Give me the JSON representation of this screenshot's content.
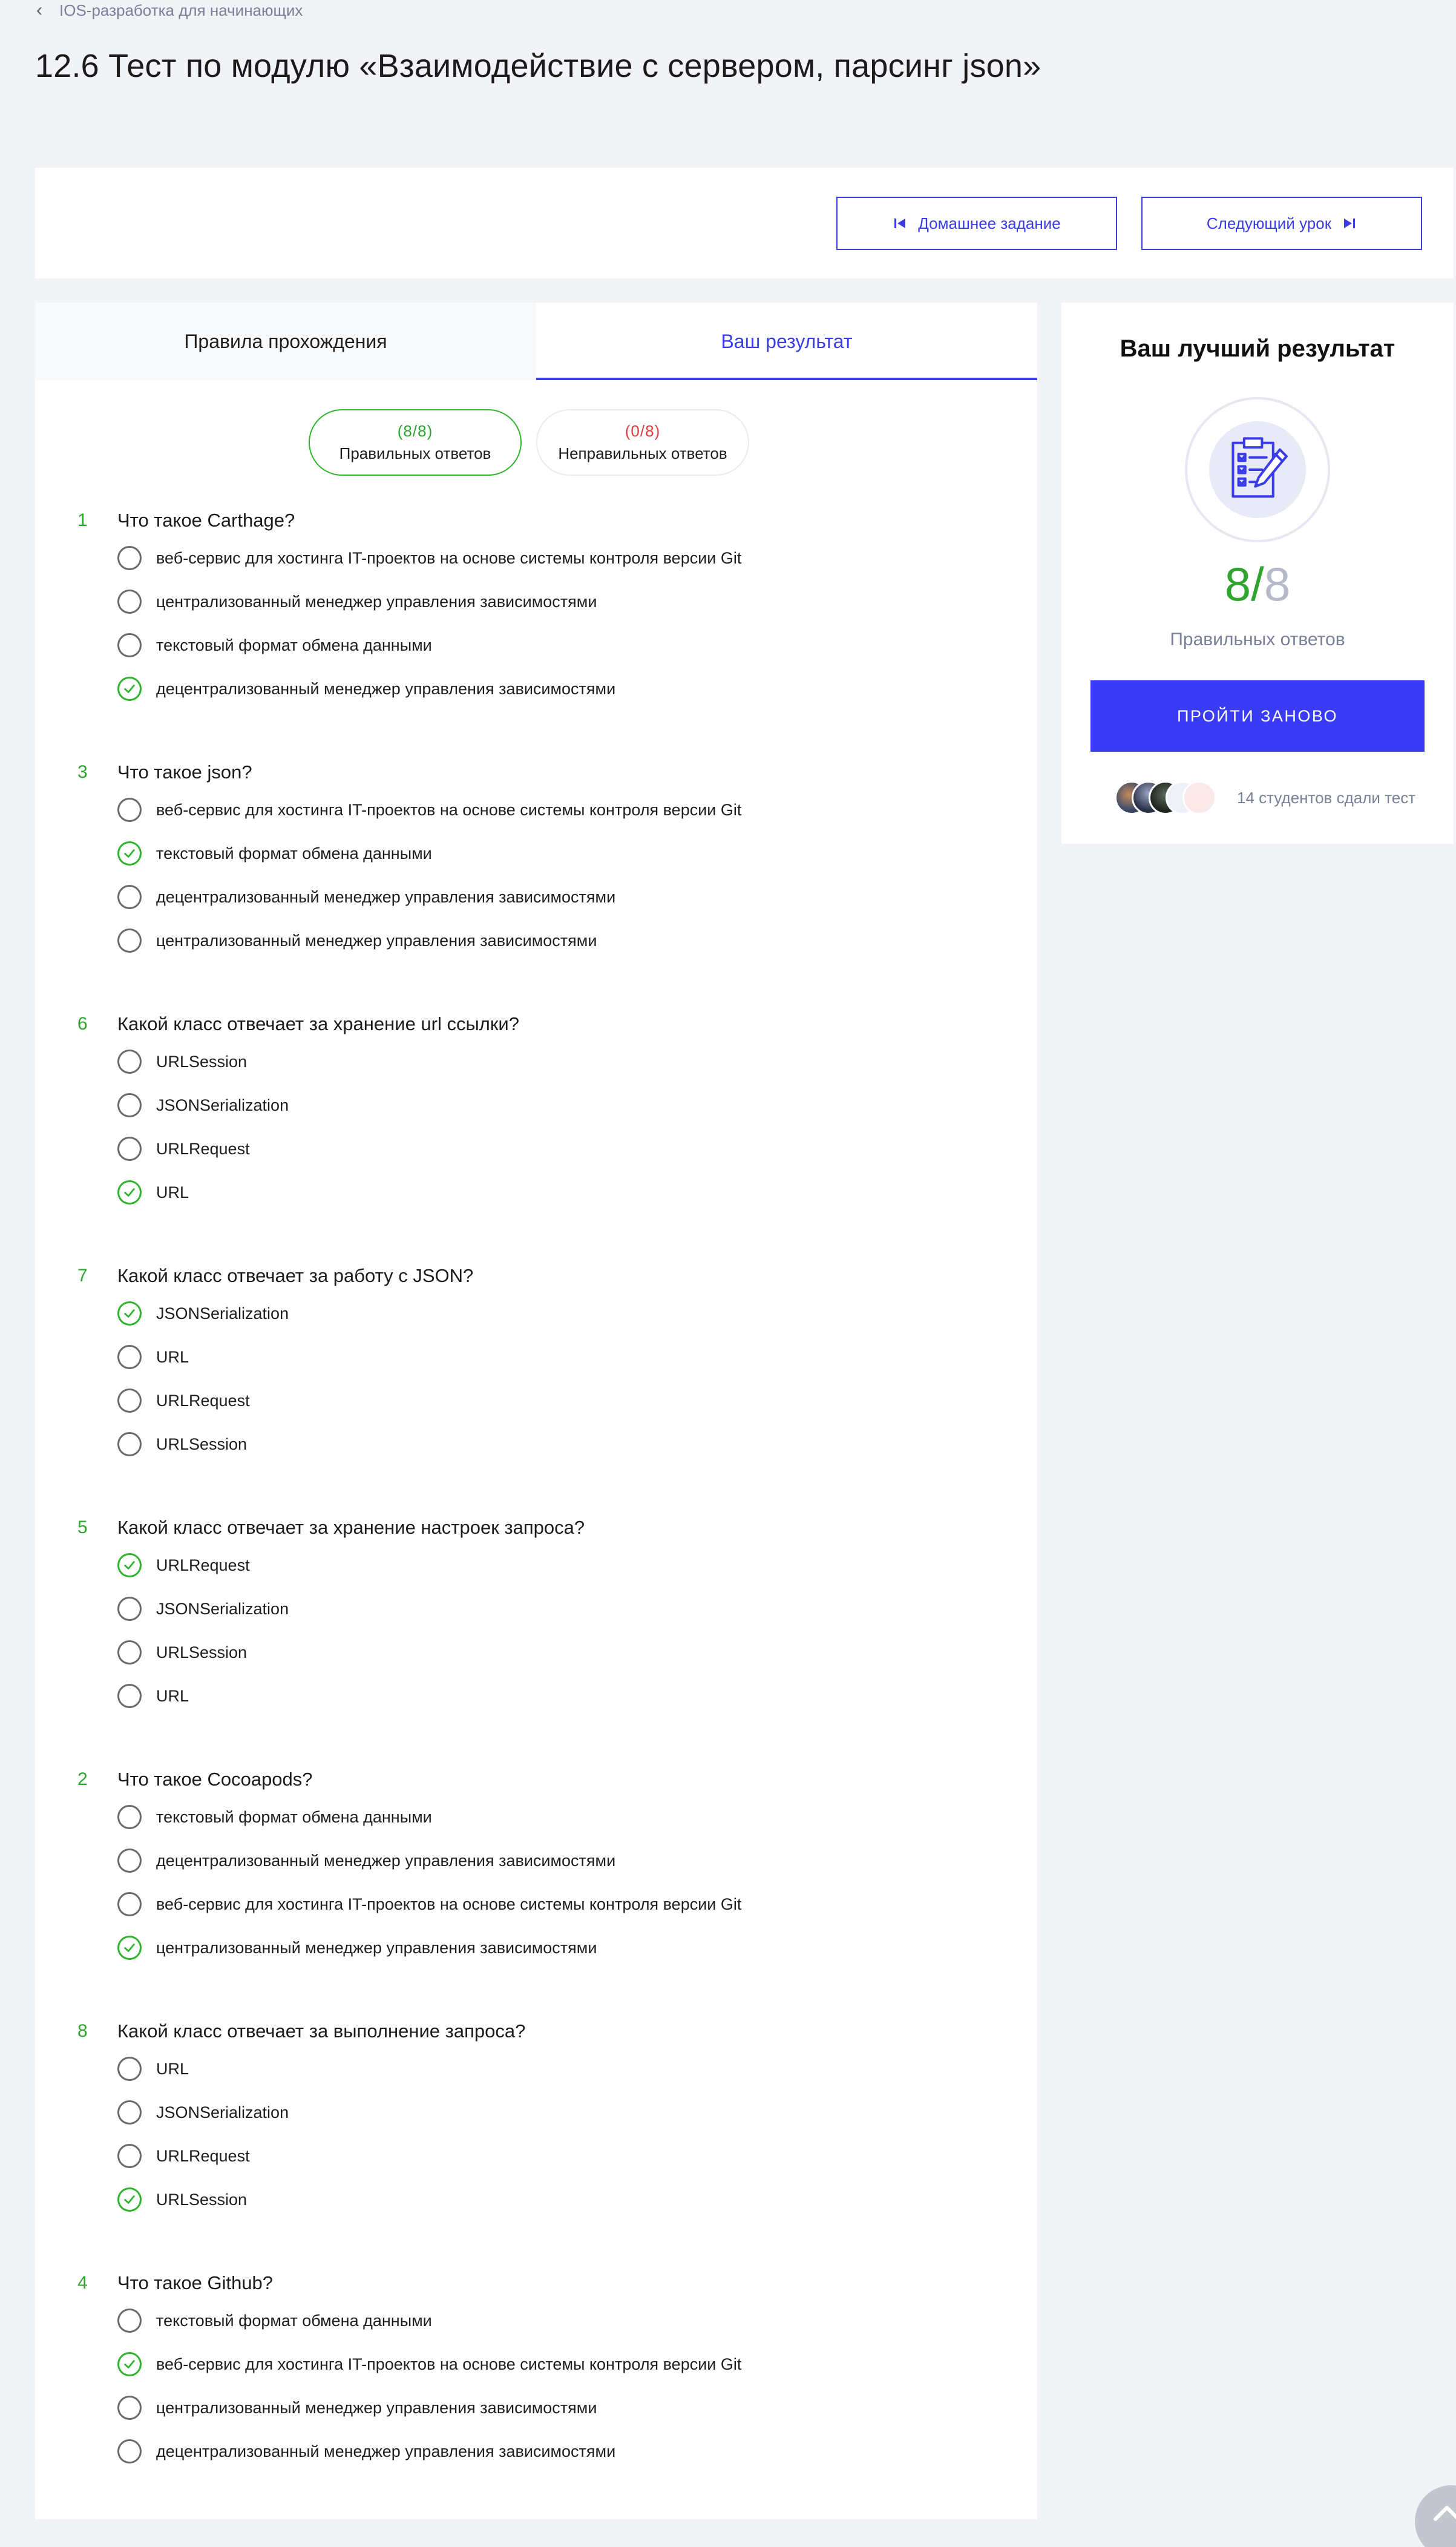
{
  "breadcrumb": {
    "label": "IOS-разработка для начинающих"
  },
  "page": {
    "title": "12.6 Тест по модулю «Взаимодействие с сервером, парсинг json»"
  },
  "nav": {
    "homework_label": "Домашнее задание",
    "next_label": "Следующий урок"
  },
  "tabs": [
    {
      "label": "Правила прохождения",
      "active": false
    },
    {
      "label": "Ваш результат",
      "active": true
    }
  ],
  "filters": {
    "correct": {
      "count": "(8/8)",
      "label": "Правильных ответов"
    },
    "wrong": {
      "count": "(0/8)",
      "label": "Неправильных ответов"
    }
  },
  "questions": [
    {
      "number": "1",
      "text": "Что такое Carthage?",
      "options": [
        {
          "label": "веб-сервис для хостинга IT-проектов на основе системы контроля версии Git",
          "checked": false
        },
        {
          "label": "централизованный менеджер управления зависимостями",
          "checked": false
        },
        {
          "label": "текстовый формат обмена данными",
          "checked": false
        },
        {
          "label": "децентрализованный менеджер управления зависимостями",
          "checked": true
        }
      ]
    },
    {
      "number": "3",
      "text": "Что такое json?",
      "options": [
        {
          "label": "веб-сервис для хостинга IT-проектов на основе системы контроля версии Git",
          "checked": false
        },
        {
          "label": "текстовый формат обмена данными",
          "checked": true
        },
        {
          "label": "децентрализованный менеджер управления зависимостями",
          "checked": false
        },
        {
          "label": "централизованный менеджер управления зависимостями",
          "checked": false
        }
      ]
    },
    {
      "number": "6",
      "text": "Какой класс отвечает за хранение url ссылки?",
      "options": [
        {
          "label": "URLSession",
          "checked": false
        },
        {
          "label": "JSONSerialization",
          "checked": false
        },
        {
          "label": "URLRequest",
          "checked": false
        },
        {
          "label": "URL",
          "checked": true
        }
      ]
    },
    {
      "number": "7",
      "text": "Какой класс отвечает за работу с JSON?",
      "options": [
        {
          "label": "JSONSerialization",
          "checked": true
        },
        {
          "label": "URL",
          "checked": false
        },
        {
          "label": "URLRequest",
          "checked": false
        },
        {
          "label": "URLSession",
          "checked": false
        }
      ]
    },
    {
      "number": "5",
      "text": "Какой класс отвечает за хранение настроек запроса?",
      "options": [
        {
          "label": "URLRequest",
          "checked": true
        },
        {
          "label": "JSONSerialization",
          "checked": false
        },
        {
          "label": "URLSession",
          "checked": false
        },
        {
          "label": "URL",
          "checked": false
        }
      ]
    },
    {
      "number": "2",
      "text": "Что такое Cocoapods?",
      "options": [
        {
          "label": "текстовый формат обмена данными",
          "checked": false
        },
        {
          "label": "децентрализованный менеджер управления зависимостями",
          "checked": false
        },
        {
          "label": "веб-сервис для хостинга IT-проектов на основе системы контроля версии Git",
          "checked": false
        },
        {
          "label": "централизованный менеджер управления зависимостями",
          "checked": true
        }
      ]
    },
    {
      "number": "8",
      "text": "Какой класс отвечает за выполнение запроса?",
      "options": [
        {
          "label": "URL",
          "checked": false
        },
        {
          "label": "JSONSerialization",
          "checked": false
        },
        {
          "label": "URLRequest",
          "checked": false
        },
        {
          "label": "URLSession",
          "checked": true
        }
      ]
    },
    {
      "number": "4",
      "text": "Что такое Github?",
      "options": [
        {
          "label": "текстовый формат обмена данными",
          "checked": false
        },
        {
          "label": "веб-сервис для хостинга IT-проектов на основе системы контроля версии Git",
          "checked": true
        },
        {
          "label": "централизованный менеджер управления зависимостями",
          "checked": false
        },
        {
          "label": "децентрализованный менеджер управления зависимостями",
          "checked": false
        }
      ]
    }
  ],
  "sidebar": {
    "title": "Ваш лучший результат",
    "icon": "test-document-icon",
    "score_got": "8",
    "score_total": "8",
    "score_label": "Правильных ответов",
    "retry_label": "ПРОЙТИ ЗАНОВО",
    "students_text": "14 студентов сдали тест"
  },
  "colors": {
    "accent": "#3a3ce8",
    "success": "#2fa52f",
    "error": "#e23a3a",
    "muted": "#7b7f97"
  }
}
